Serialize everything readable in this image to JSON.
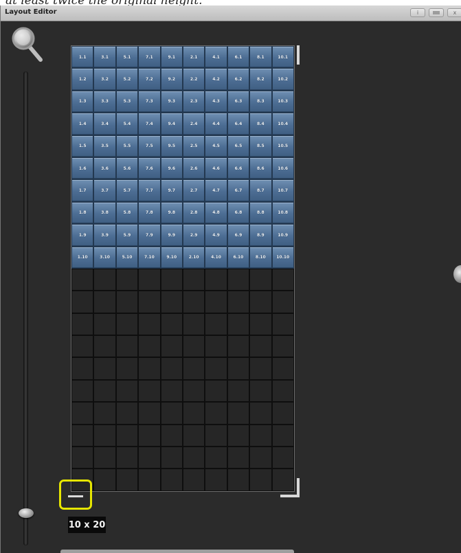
{
  "caption": "at least twice the original height.",
  "window": {
    "title": "Layout Editor",
    "buttons": [
      "i",
      "",
      "x"
    ]
  },
  "grid": {
    "columns": 10,
    "rows": 20,
    "column_ids": [
      "1",
      "3",
      "5",
      "7",
      "9",
      "2",
      "4",
      "6",
      "8",
      "10"
    ],
    "filled_rows": 10
  },
  "size_label": "10 x 20",
  "icons": {
    "zoom": "magnifier-icon",
    "zoom_slider": "vertical-slider",
    "resize": "resize-handle-icon"
  },
  "colors": {
    "cell_fill": "#4c6d93",
    "highlight": "#e6e600",
    "background": "#2b2b2b"
  }
}
